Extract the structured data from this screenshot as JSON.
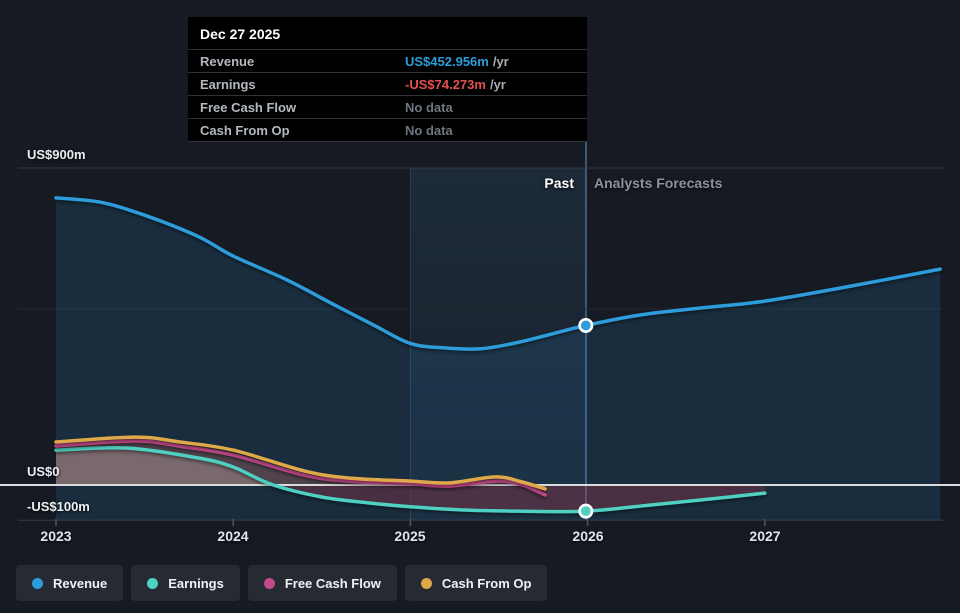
{
  "annotations": {
    "past": "Past",
    "forecast": "Analysts Forecasts"
  },
  "tooltip": {
    "date": "Dec 27 2025",
    "rows": [
      {
        "label": "Revenue",
        "value": "US$452.956m",
        "suffix": "/yr",
        "value_color": "#2d9cdb"
      },
      {
        "label": "Earnings",
        "value": "-US$74.273m",
        "suffix": "/yr",
        "value_color": "#e25050"
      },
      {
        "label": "Free Cash Flow",
        "value": "No data",
        "suffix": "",
        "value_color": "#6d7680"
      },
      {
        "label": "Cash From Op",
        "value": "No data",
        "suffix": "",
        "value_color": "#6d7680"
      }
    ]
  },
  "legend": [
    {
      "label": "Revenue"
    },
    {
      "label": "Earnings"
    },
    {
      "label": "Free Cash Flow"
    },
    {
      "label": "Cash From Op"
    }
  ],
  "chart_data": {
    "type": "line",
    "title": "",
    "x_unit": "year",
    "xlim": [
      2023,
      2028
    ],
    "ylim": [
      -100,
      900
    ],
    "grid": true,
    "legend_position": "bottom-left",
    "x_axis": {
      "ticks": [
        {
          "label": "2023",
          "year": 2023
        },
        {
          "label": "2024",
          "year": 2024
        },
        {
          "label": "2025",
          "year": 2025
        },
        {
          "label": "2026",
          "year": 2026
        },
        {
          "label": "2027",
          "year": 2027
        }
      ]
    },
    "y_axis": {
      "ticks": [
        {
          "label": "US$900m",
          "value": 900
        },
        {
          "label": "US$0",
          "value": 0
        },
        {
          "label": "-US$100m",
          "value": -100
        }
      ],
      "unlabeled_gridline_value": 500
    },
    "divider_year": 2025.99,
    "hover_band": {
      "from_year": 2025.0,
      "to_year": 2025.99
    },
    "series": [
      {
        "name": "Revenue",
        "color": "#2d9cdb",
        "fill": "rgba(45,156,219,0.15)",
        "fill_to": "bottom",
        "points": [
          [
            2023.0,
            815
          ],
          [
            2023.25,
            803
          ],
          [
            2023.5,
            766
          ],
          [
            2023.8,
            706
          ],
          [
            2024.0,
            650
          ],
          [
            2024.3,
            583
          ],
          [
            2024.55,
            517
          ],
          [
            2024.8,
            452
          ],
          [
            2025.0,
            402
          ],
          [
            2025.2,
            389
          ],
          [
            2025.4,
            387
          ],
          [
            2025.6,
            404
          ],
          [
            2025.8,
            429
          ],
          [
            2025.99,
            452.956
          ],
          [
            2026.3,
            483
          ],
          [
            2026.65,
            503
          ],
          [
            2027.0,
            522
          ],
          [
            2027.5,
            566
          ],
          [
            2027.99,
            613
          ]
        ]
      },
      {
        "name": "Earnings",
        "color": "#4ed0c2",
        "split_at_zero": true,
        "fill_positive": "rgba(219,224,229,0.30)",
        "fill_negative": "rgba(178,52,70,0.32)",
        "points": [
          [
            2023.0,
            99
          ],
          [
            2023.4,
            105
          ],
          [
            2023.8,
            77
          ],
          [
            2024.0,
            51
          ],
          [
            2024.22,
            1
          ],
          [
            2024.5,
            -34
          ],
          [
            2024.75,
            -50
          ],
          [
            2025.0,
            -62
          ],
          [
            2025.3,
            -71
          ],
          [
            2025.6,
            -74
          ],
          [
            2025.99,
            -74.273
          ],
          [
            2026.35,
            -57
          ],
          [
            2026.65,
            -42
          ],
          [
            2027.0,
            -23
          ]
        ]
      },
      {
        "name": "Free Cash Flow",
        "color": "#c4498a",
        "fill": "rgba(196,73,138,0.20)",
        "points": [
          [
            2023.0,
            111
          ],
          [
            2023.45,
            125
          ],
          [
            2023.7,
            110
          ],
          [
            2024.0,
            85
          ],
          [
            2024.4,
            28
          ],
          [
            2024.65,
            11
          ],
          [
            2025.0,
            3
          ],
          [
            2025.22,
            -3
          ],
          [
            2025.48,
            11
          ],
          [
            2025.62,
            2
          ],
          [
            2025.76,
            -28
          ]
        ]
      },
      {
        "name": "Cash From Op",
        "color": "#dfa849",
        "fill": "rgba(223,168,73,0.14)",
        "points": [
          [
            2023.0,
            122
          ],
          [
            2023.45,
            136
          ],
          [
            2023.7,
            122
          ],
          [
            2024.0,
            99
          ],
          [
            2024.4,
            40
          ],
          [
            2024.65,
            20
          ],
          [
            2025.0,
            11
          ],
          [
            2025.22,
            6
          ],
          [
            2025.48,
            23
          ],
          [
            2025.62,
            10
          ],
          [
            2025.76,
            -11
          ]
        ]
      }
    ],
    "markers": [
      {
        "series": "Revenue",
        "year": 2025.99,
        "value": 452.956
      },
      {
        "series": "Earnings",
        "year": 2025.99,
        "value": -74.273
      }
    ]
  }
}
